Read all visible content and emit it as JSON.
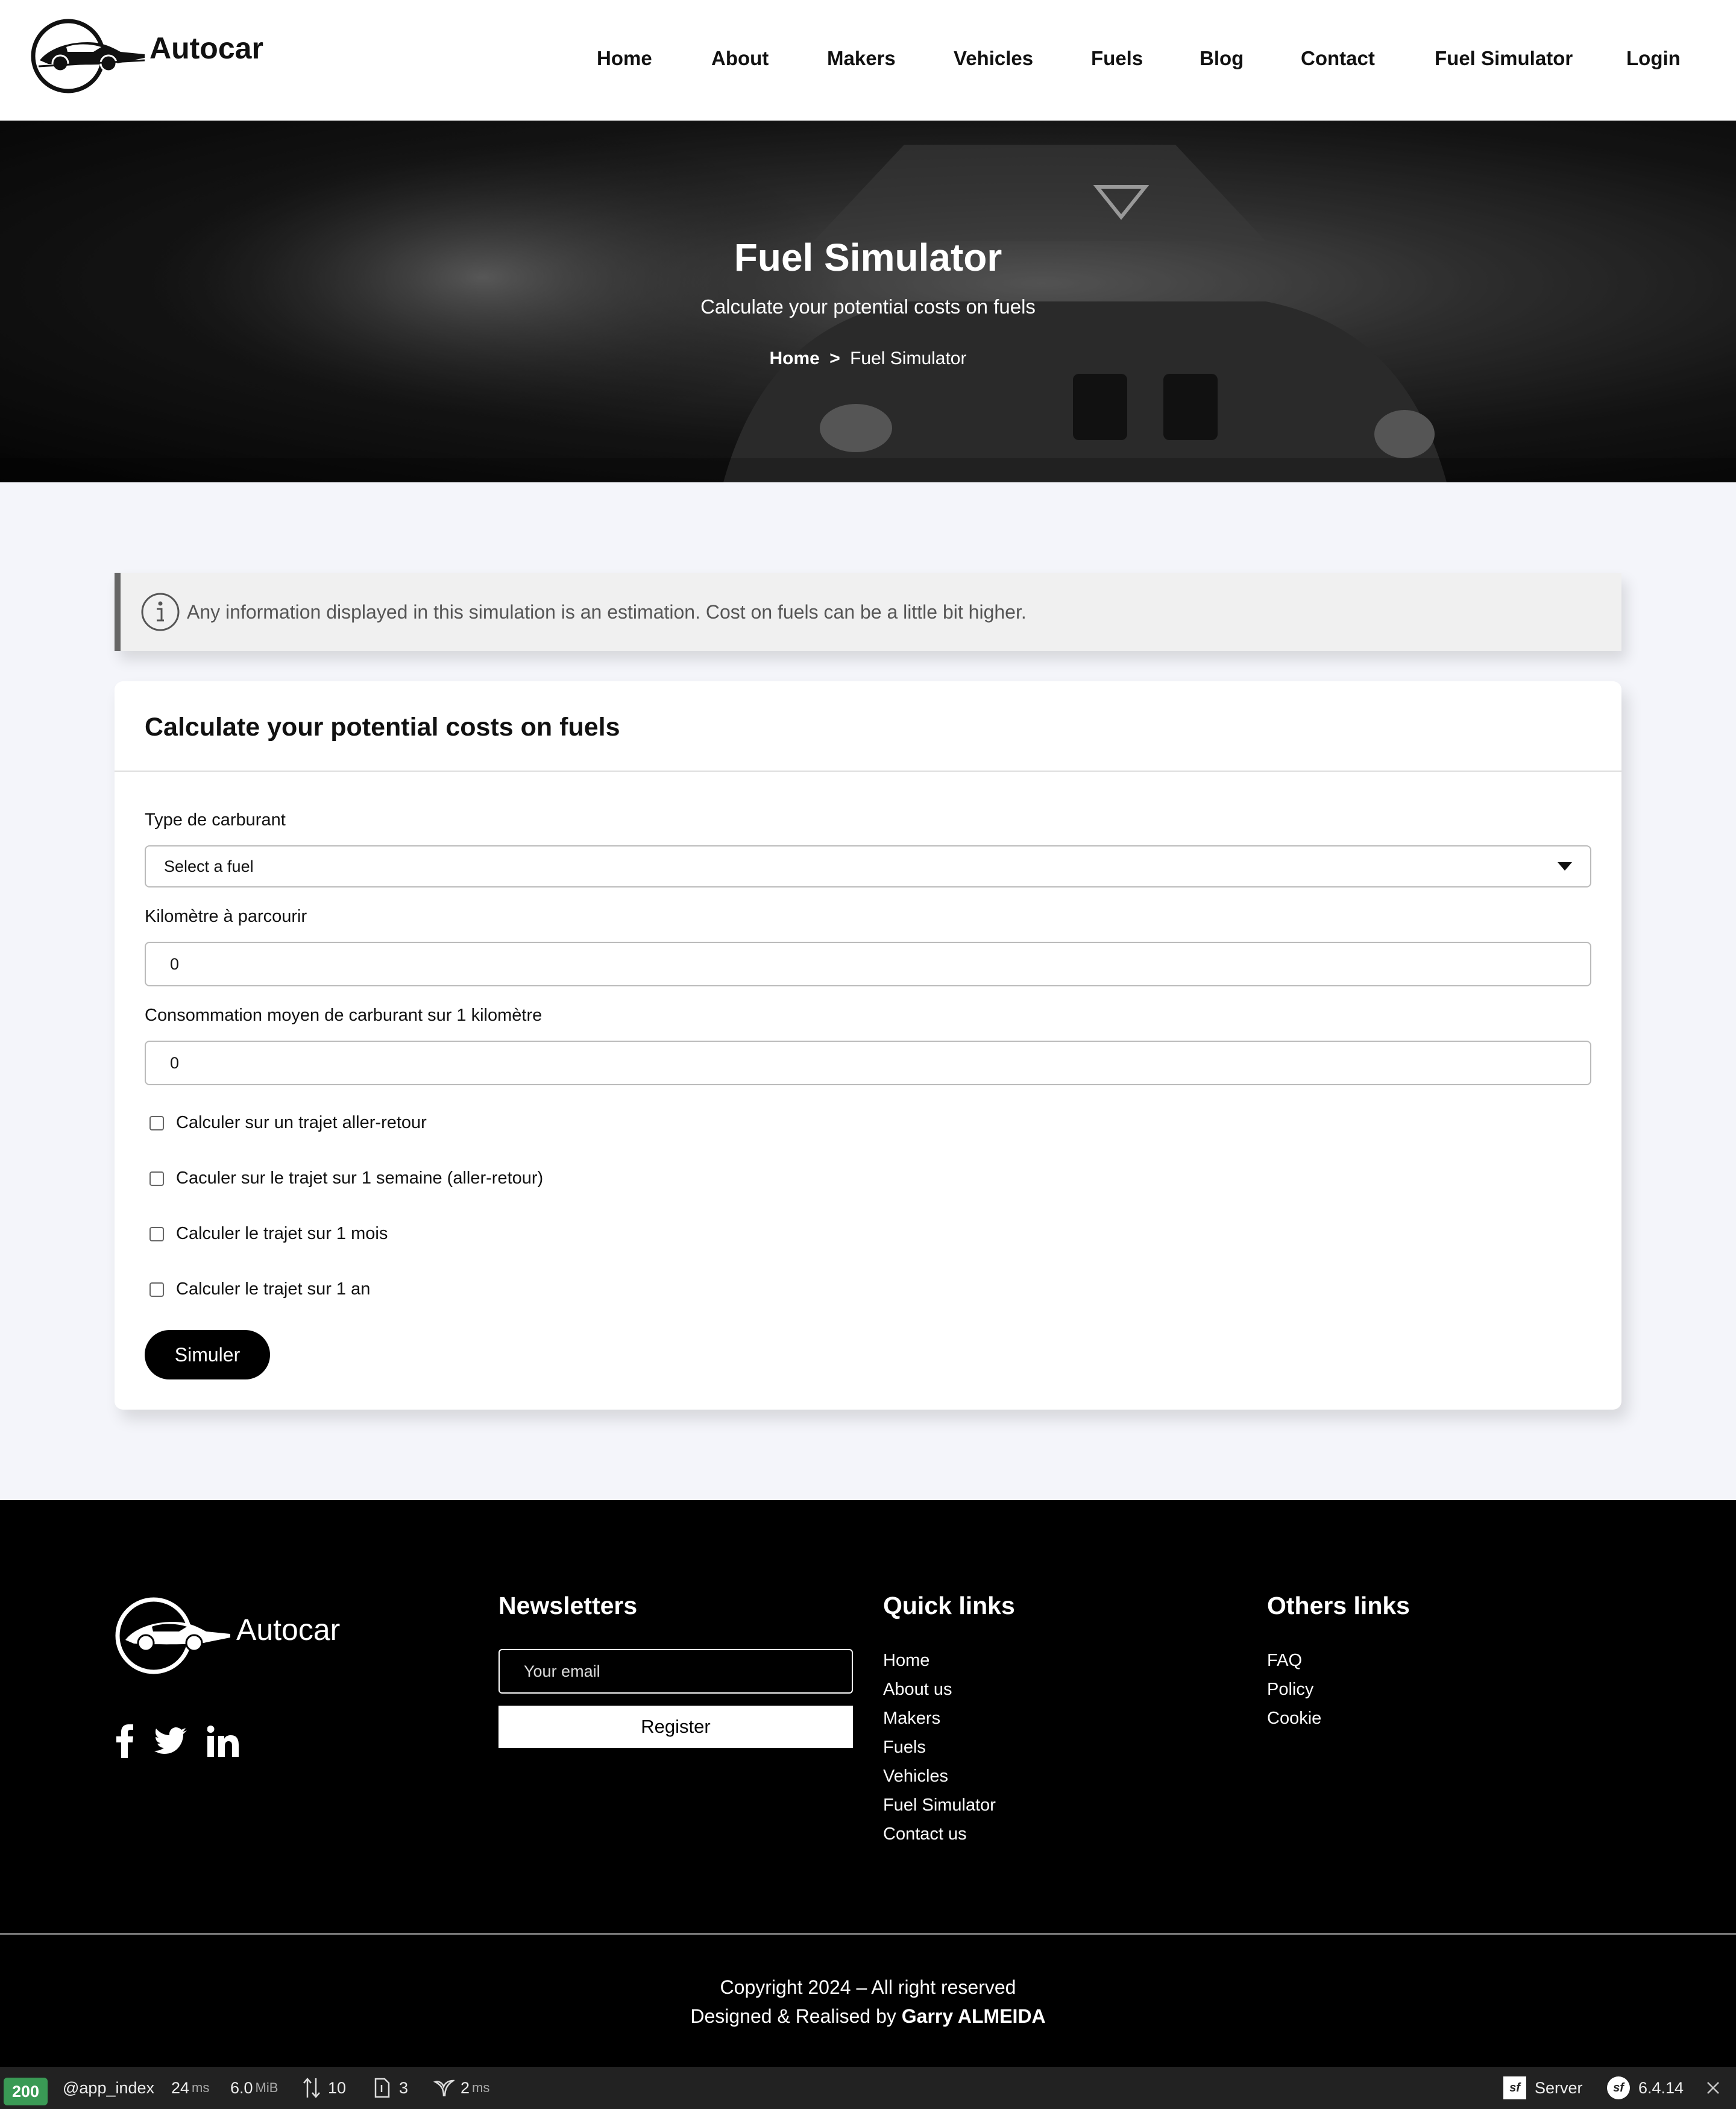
{
  "brand": {
    "name": "Autocar"
  },
  "nav": {
    "items": [
      {
        "label": "Home"
      },
      {
        "label": "About"
      },
      {
        "label": "Makers"
      },
      {
        "label": "Vehicles"
      },
      {
        "label": "Fuels"
      },
      {
        "label": "Blog"
      },
      {
        "label": "Contact"
      },
      {
        "label": "Fuel Simulator"
      },
      {
        "label": "Login"
      }
    ]
  },
  "hero": {
    "title": "Fuel Simulator",
    "subtitle": "Calculate your potential costs on fuels",
    "breadcrumb": {
      "home": "Home",
      "separator": ">",
      "current": "Fuel Simulator"
    }
  },
  "alert": {
    "icon": "info-icon",
    "message": "Any information displayed in this simulation is an estimation. Cost on fuels can be a little bit higher."
  },
  "form": {
    "title": "Calculate your potential costs on fuels",
    "fuel_label": "Type de carburant",
    "fuel_selected": "Select a fuel",
    "distance_label": "Kilomètre à parcourir",
    "distance_value": "0",
    "consumption_label": "Consommation moyen de carburant sur 1 kilomètre",
    "consumption_value": "0",
    "checkboxes": [
      {
        "label": "Calculer sur un trajet aller-retour",
        "checked": false
      },
      {
        "label": "Caculer sur le trajet sur 1 semaine (aller-retour)",
        "checked": false
      },
      {
        "label": "Calculer le trajet sur 1 mois",
        "checked": false
      },
      {
        "label": "Calculer le trajet sur 1 an",
        "checked": false
      }
    ],
    "submit_label": "Simuler"
  },
  "footer": {
    "brand": "Autocar",
    "social": [
      "facebook-icon",
      "twitter-icon",
      "linkedin-icon"
    ],
    "newsletter": {
      "title": "Newsletters",
      "email_placeholder": "Your email",
      "button_label": "Register"
    },
    "quick_links": {
      "title": "Quick links",
      "items": [
        "Home",
        "About us",
        "Makers",
        "Fuels",
        "Vehicles",
        "Fuel Simulator",
        "Contact us"
      ]
    },
    "other_links": {
      "title": "Others links",
      "items": [
        "FAQ",
        "Policy",
        "Cookie"
      ]
    },
    "copyright": "Copyright 2024 – All right reserved",
    "designed_prefix": "Designed & Realised by",
    "designer": "Garry ALMEIDA"
  },
  "debug_toolbar": {
    "status": "200",
    "route": "@app_index",
    "time_value": "24",
    "time_unit": "ms",
    "memory_value": "6.0",
    "memory_unit": "MiB",
    "requests": "10",
    "files": "3",
    "twig_value": "2",
    "twig_unit": "ms",
    "server_label": "Server",
    "version": "6.4.14"
  },
  "colors": {
    "accent": "#000000",
    "page_bg": "#f4f5fa",
    "status_ok": "#3a9a55"
  }
}
